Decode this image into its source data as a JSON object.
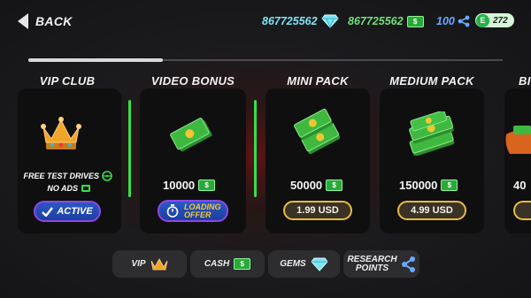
{
  "topbar": {
    "back_label": "BACK",
    "gems_value": "867725562",
    "cash_value": "867725562",
    "cash_symbol": "$",
    "research_value": "100",
    "energy_letter": "E",
    "energy_value": "272"
  },
  "shop": {
    "cards": [
      {
        "title": "VIP CLUB",
        "perk1": "FREE TEST DRIVES",
        "perk2": "NO ADS",
        "button": "ACTIVE"
      },
      {
        "title": "VIDEO BONUS",
        "amount": "10000",
        "button_line1": "LOADING",
        "button_line2": "OFFER"
      },
      {
        "title": "MINI PACK",
        "amount": "50000",
        "price": "1.99 USD"
      },
      {
        "title": "MEDIUM PACK",
        "amount": "150000",
        "price": "4.99 USD"
      },
      {
        "title": "BI",
        "amount": "40"
      }
    ]
  },
  "bottom_nav": {
    "vip": "VIP",
    "cash": "CASH",
    "gems": "GEMS",
    "research_line1": "RESEARCH",
    "research_line2": "POINTS"
  },
  "colors": {
    "accent_green": "#35e04a",
    "price_border": "#e9bb3b",
    "button_purple": "#8f47e6",
    "gems_text": "#7fe3f3",
    "research_text": "#6aa8ff"
  }
}
